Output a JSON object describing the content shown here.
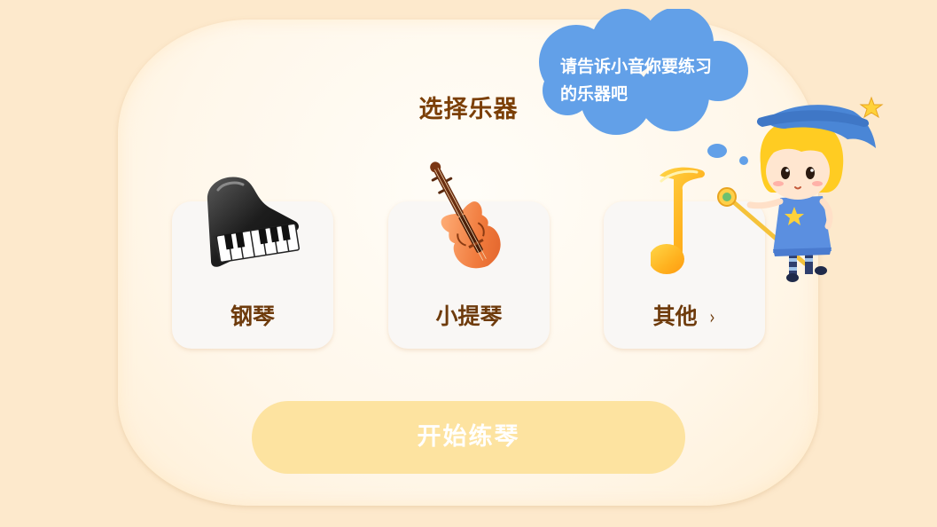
{
  "page": {
    "title": "选择乐器",
    "start_button_label": "开始练琴"
  },
  "speech_bubble": {
    "text_line1": "请告诉小音你要练习",
    "text_line2": "的乐器吧"
  },
  "instruments": [
    {
      "label": "钢琴",
      "icon": "piano-icon"
    },
    {
      "label": "小提琴",
      "icon": "violin-icon"
    },
    {
      "label": "其他",
      "icon": "music-note-icon",
      "chevron": "›"
    }
  ],
  "colors": {
    "background": "#fde9cc",
    "title_text": "#7b3f06",
    "card_text": "#6e3b0c",
    "start_button": "#fde3a0",
    "bubble": "#62a0e8"
  }
}
